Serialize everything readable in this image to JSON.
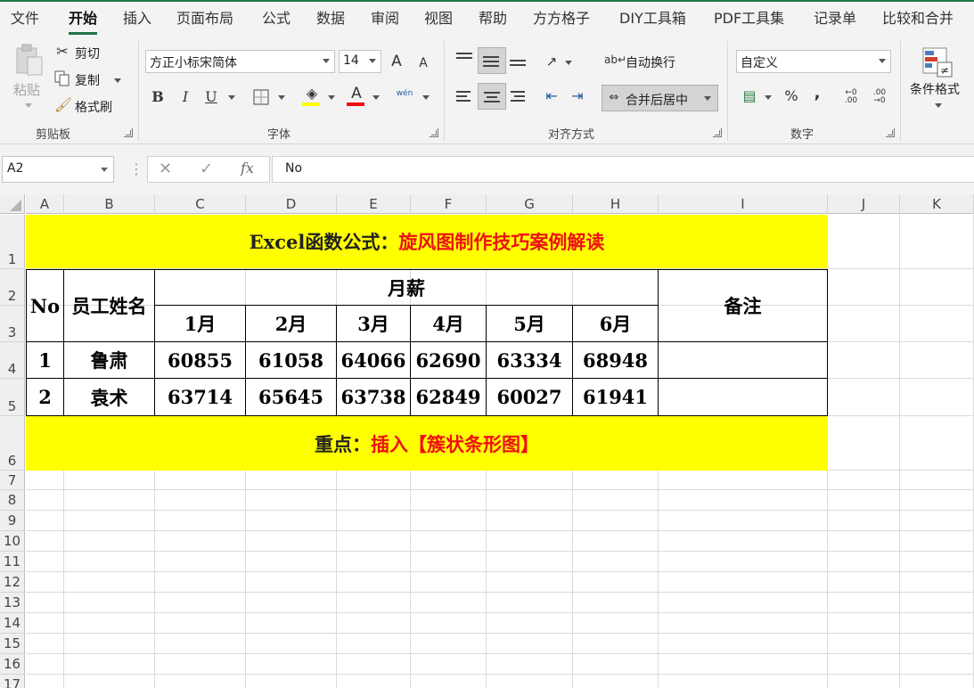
{
  "menu": [
    "文件",
    "开始",
    "插入",
    "页面布局",
    "公式",
    "数据",
    "审阅",
    "视图",
    "帮助",
    "方方格子",
    "DIY工具箱",
    "PDF工具集",
    "记录单",
    "比较和合并"
  ],
  "ribbon": {
    "clipboard": {
      "paste": "粘贴",
      "cut": "剪切",
      "copy": "复制",
      "format_painter": "格式刷",
      "group": "剪贴板"
    },
    "font": {
      "name": "方正小标宋简体",
      "size": "14",
      "bold": "B",
      "italic": "I",
      "underline": "U",
      "increase": "A",
      "decrease": "A",
      "font_color": "A",
      "phonetic": "wén",
      "group": "字体"
    },
    "alignment": {
      "wrap": "自动换行",
      "merge": "合并后居中",
      "group": "对齐方式"
    },
    "number": {
      "format": "自定义",
      "percent": "%",
      "comma": ",",
      "group": "数字"
    },
    "styles": {
      "conditional": "条件格式"
    }
  },
  "formula_bar": {
    "name_box": "A2",
    "fx": "fx",
    "value": "No"
  },
  "columns": [
    "A",
    "B",
    "C",
    "D",
    "E",
    "F",
    "G",
    "H",
    "I",
    "J",
    "K"
  ],
  "rows": [
    "1",
    "2",
    "3",
    "4",
    "5",
    "6",
    "7",
    "8",
    "9",
    "10",
    "11",
    "12",
    "13",
    "14",
    "15",
    "16",
    "17"
  ],
  "sheet": {
    "title_black": "Excel函数公式：",
    "title_red": "旋风图制作技巧案例解读",
    "header_no": "No",
    "header_name": "员工姓名",
    "header_salary": "月薪",
    "header_note": "备注",
    "months": [
      "1月",
      "2月",
      "3月",
      "4月",
      "5月",
      "6月"
    ],
    "records": [
      {
        "no": "1",
        "name": "鲁肃",
        "values": [
          "60855",
          "61058",
          "64066",
          "62690",
          "63334",
          "68948"
        ]
      },
      {
        "no": "2",
        "name": "袁术",
        "values": [
          "63714",
          "65645",
          "63738",
          "62849",
          "60027",
          "61941"
        ]
      }
    ],
    "footer_black": "重点：",
    "footer_red": "插入【簇状条形图】"
  },
  "colors": {
    "accent": "#217346",
    "highlight": "#ffff00",
    "red_text": "#ee1111"
  }
}
